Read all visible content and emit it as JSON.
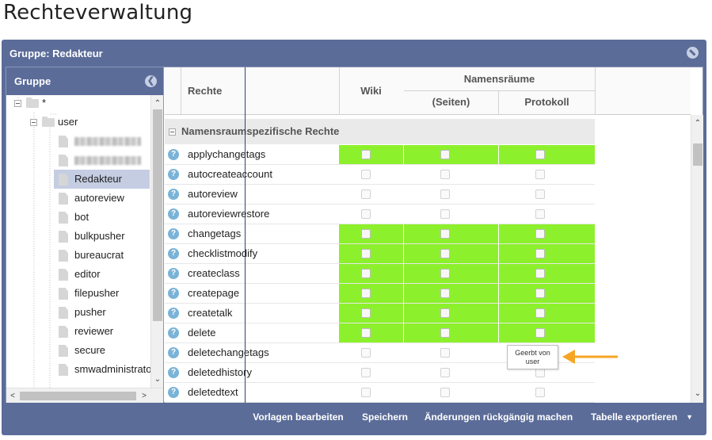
{
  "page_title": "Rechteverwaltung",
  "window": {
    "title": "Gruppe: Redakteur"
  },
  "left_panel": {
    "header": "Gruppe",
    "tree": [
      {
        "label": "*",
        "kind": "folder"
      },
      {
        "label": "user",
        "kind": "folder"
      },
      {
        "label": "",
        "kind": "doc",
        "blurred": true
      },
      {
        "label": "",
        "kind": "doc",
        "blurred": true
      },
      {
        "label": "Redakteur",
        "kind": "doc",
        "selected": true
      },
      {
        "label": "autoreview",
        "kind": "doc"
      },
      {
        "label": "bot",
        "kind": "doc"
      },
      {
        "label": "bulkpusher",
        "kind": "doc"
      },
      {
        "label": "bureaucrat",
        "kind": "doc"
      },
      {
        "label": "editor",
        "kind": "doc"
      },
      {
        "label": "filepusher",
        "kind": "doc"
      },
      {
        "label": "pusher",
        "kind": "doc"
      },
      {
        "label": "reviewer",
        "kind": "doc"
      },
      {
        "label": "secure",
        "kind": "doc"
      },
      {
        "label": "smwadministrato",
        "kind": "doc"
      }
    ]
  },
  "grid": {
    "headers": {
      "rights": "Rechte",
      "wiki": "Wiki",
      "namespaces": "Namensräume",
      "pages": "(Seiten)",
      "log": "Protokoll"
    },
    "group_label": "Namensraumspezifische Rechte",
    "rows": [
      {
        "name": "applychangetags",
        "granted": true
      },
      {
        "name": "autocreateaccount",
        "granted": false
      },
      {
        "name": "autoreview",
        "granted": false
      },
      {
        "name": "autoreviewrestore",
        "granted": false
      },
      {
        "name": "changetags",
        "granted": true
      },
      {
        "name": "checklistmodify",
        "granted": true
      },
      {
        "name": "createclass",
        "granted": true
      },
      {
        "name": "createpage",
        "granted": true
      },
      {
        "name": "createtalk",
        "granted": true
      },
      {
        "name": "delete",
        "granted": true
      },
      {
        "name": "deletechangetags",
        "granted": false
      },
      {
        "name": "deletedhistory",
        "granted": false
      },
      {
        "name": "deletedtext",
        "granted": false
      }
    ]
  },
  "tooltip": "Geerbt von user",
  "buttons": {
    "templates": "Vorlagen bearbeiten",
    "save": "Speichern",
    "revert": "Änderungen rückgängig machen",
    "export": "Tabelle exportieren"
  },
  "colors": {
    "window_bg": "#5b6c99",
    "granted": "#8df02c",
    "selected": "#c4cde2",
    "arrow": "#f5a623"
  }
}
